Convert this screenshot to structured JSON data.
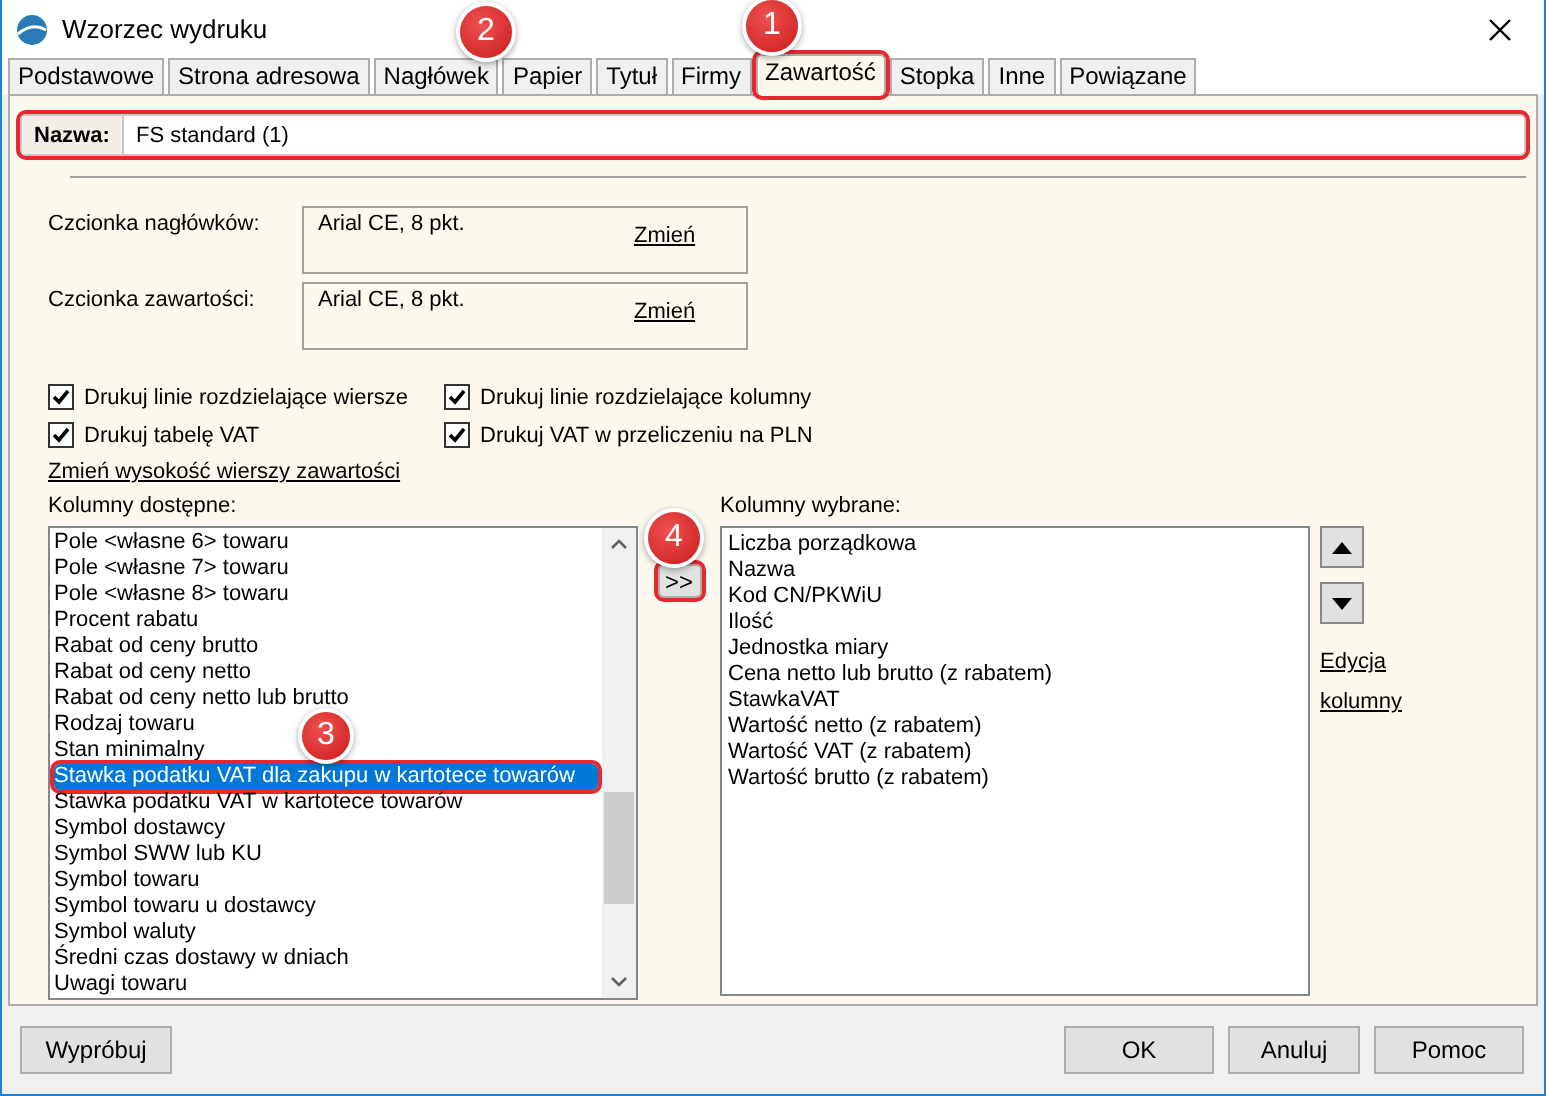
{
  "window": {
    "title": "Wzorzec wydruku"
  },
  "tabs": [
    {
      "label": "Podstawowe",
      "selected": false
    },
    {
      "label": "Strona adresowa",
      "selected": false
    },
    {
      "label": "Nagłówek",
      "selected": false
    },
    {
      "label": "Papier",
      "selected": false
    },
    {
      "label": "Tytuł",
      "selected": false
    },
    {
      "label": "Firmy",
      "selected": false
    },
    {
      "label": "Zawartość",
      "selected": true,
      "callout": "1"
    },
    {
      "label": "Stopka",
      "selected": false
    },
    {
      "label": "Inne",
      "selected": false
    },
    {
      "label": "Powiązane",
      "selected": false
    }
  ],
  "name_field": {
    "label": "Nazwa:",
    "value": "FS standard (1)",
    "callout": "2"
  },
  "fonts": [
    {
      "label": "Czcionka nagłówków:",
      "value": "Arial CE, 8 pkt.",
      "link": "Zmień"
    },
    {
      "label": "Czcionka zawartości:",
      "value": "Arial CE, 8 pkt.",
      "link": "Zmień"
    }
  ],
  "options": [
    {
      "label": "Drukuj linie rozdzielające wiersze",
      "checked": true
    },
    {
      "label": "Drukuj linie rozdzielające kolumny",
      "checked": true
    },
    {
      "label": "Drukuj tabelę VAT",
      "checked": true
    },
    {
      "label": "Drukuj VAT w przeliczeniu na PLN",
      "checked": true
    }
  ],
  "row_height_link": "Zmień wysokość wierszy zawartości",
  "available": {
    "label": "Kolumny dostępne:",
    "items": [
      {
        "text": "Pole <własne 6> towaru",
        "selected": false
      },
      {
        "text": "Pole <własne 7> towaru",
        "selected": false
      },
      {
        "text": "Pole <własne 8> towaru",
        "selected": false
      },
      {
        "text": "Procent rabatu",
        "selected": false
      },
      {
        "text": "Rabat od ceny brutto",
        "selected": false
      },
      {
        "text": "Rabat od ceny netto",
        "selected": false
      },
      {
        "text": "Rabat od ceny netto lub brutto",
        "selected": false
      },
      {
        "text": "Rodzaj towaru",
        "selected": false
      },
      {
        "text": "Stan minimalny",
        "selected": false
      },
      {
        "text": "Stawka podatku VAT dla zakupu w kartotece towarów",
        "selected": true,
        "callout": "3"
      },
      {
        "text": "Stawka podatku VAT w kartotece towarów",
        "selected": false
      },
      {
        "text": "Symbol dostawcy",
        "selected": false
      },
      {
        "text": "Symbol SWW lub KU",
        "selected": false
      },
      {
        "text": "Symbol towaru",
        "selected": false
      },
      {
        "text": "Symbol towaru u dostawcy",
        "selected": false
      },
      {
        "text": "Symbol waluty",
        "selected": false
      },
      {
        "text": "Średni czas dostawy w dniach",
        "selected": false
      },
      {
        "text": "Uwagi towaru",
        "selected": false
      }
    ]
  },
  "move_button": {
    "label": ">>",
    "callout": "4"
  },
  "selected_columns": {
    "label": "Kolumny wybrane:",
    "items": [
      {
        "text": "Liczba porządkowa"
      },
      {
        "text": "Nazwa"
      },
      {
        "text": "Kod CN/PKWiU"
      },
      {
        "text": "Ilość"
      },
      {
        "text": "Jednostka miary"
      },
      {
        "text": "Cena netto lub brutto (z rabatem)"
      },
      {
        "text": "StawkaVAT"
      },
      {
        "text": "Wartość netto (z rabatem)"
      },
      {
        "text": "Wartość VAT (z rabatem)"
      },
      {
        "text": "Wartość brutto (z rabatem)"
      }
    ]
  },
  "edit_link": "Edycja kolumny",
  "footer": {
    "left_buttons": [
      "Wypróbuj"
    ],
    "right_buttons": [
      "OK",
      "Anuluj",
      "Pomoc"
    ]
  }
}
